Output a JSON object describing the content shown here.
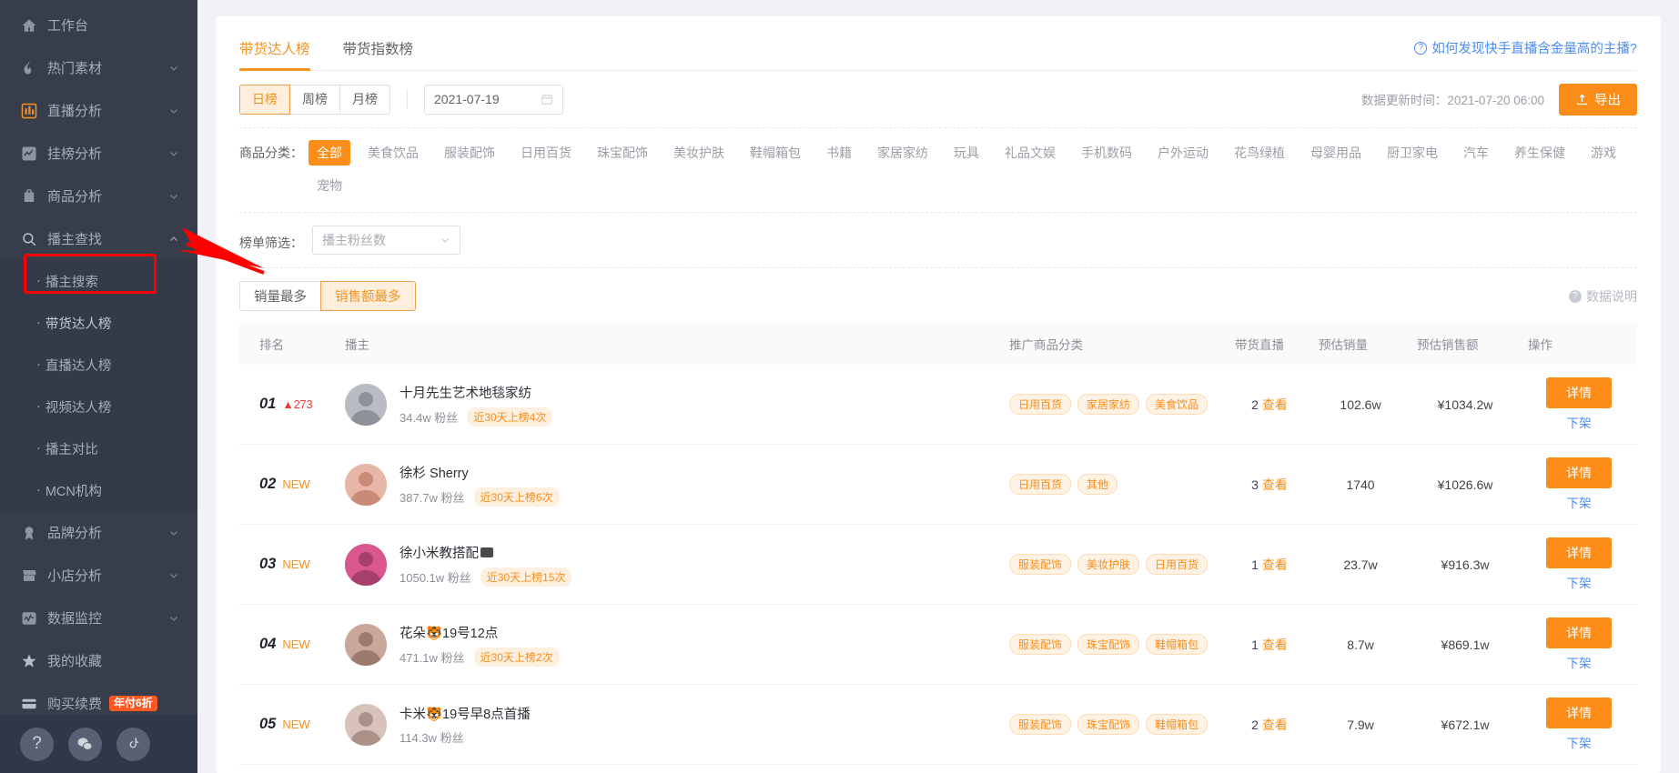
{
  "sidebar": {
    "items": [
      {
        "label": "工作台",
        "icon": "home-icon",
        "expandable": false,
        "id": "workbench"
      },
      {
        "label": "热门素材",
        "icon": "fire-icon",
        "expandable": true,
        "id": "hot-material"
      },
      {
        "label": "直播分析",
        "icon": "bar-chart-icon",
        "expandable": true,
        "id": "live-analysis"
      },
      {
        "label": "挂榜分析",
        "icon": "trend-icon",
        "expandable": true,
        "id": "rank-analysis"
      },
      {
        "label": "商品分析",
        "icon": "bag-icon",
        "expandable": true,
        "id": "product-analysis"
      },
      {
        "label": "播主查找",
        "icon": "search-icon",
        "expandable": true,
        "expanded": true,
        "id": "host-find"
      }
    ],
    "sub_items": [
      {
        "label": "播主搜索",
        "id": "host-search"
      },
      {
        "label": "带货达人榜",
        "id": "带货达人榜",
        "highlighted": true
      },
      {
        "label": "直播达人榜",
        "id": "live-talent-rank"
      },
      {
        "label": "视频达人榜",
        "id": "video-talent-rank"
      },
      {
        "label": "播主对比",
        "id": "host-compare"
      },
      {
        "label": "MCN机构",
        "id": "mcn-agency"
      }
    ],
    "items_bottom": [
      {
        "label": "品牌分析",
        "icon": "medal-icon",
        "expandable": true,
        "id": "brand-analysis"
      },
      {
        "label": "小店分析",
        "icon": "shop-icon",
        "expandable": true,
        "id": "shop-analysis"
      },
      {
        "label": "数据监控",
        "icon": "monitor-icon",
        "expandable": true,
        "id": "data-monitor"
      },
      {
        "label": "我的收藏",
        "icon": "star-icon",
        "expandable": false,
        "id": "my-favorites"
      },
      {
        "label": "购买续费",
        "icon": "card-icon",
        "expandable": false,
        "id": "purchase-renew",
        "badge": "年付6折"
      }
    ],
    "footer_icons": [
      "question-icon",
      "wechat-icon",
      "douyin-icon"
    ]
  },
  "tabs": [
    {
      "label": "带货达人榜",
      "active": true
    },
    {
      "label": "带货指数榜",
      "active": false
    }
  ],
  "howto_link": "如何发现快手直播含金量高的主播?",
  "period": {
    "options": [
      {
        "label": "日榜",
        "active": true
      },
      {
        "label": "周榜",
        "active": false
      },
      {
        "label": "月榜",
        "active": false
      }
    ],
    "date_value": "2021-07-19"
  },
  "update_time": "数据更新时间：2021-07-20 06:00",
  "export_label": "导出",
  "category_filter": {
    "label": "商品分类：",
    "categories": [
      {
        "label": "全部",
        "active": true
      },
      {
        "label": "美食饮品",
        "active": false
      },
      {
        "label": "服装配饰",
        "active": false
      },
      {
        "label": "日用百货",
        "active": false
      },
      {
        "label": "珠宝配饰",
        "active": false
      },
      {
        "label": "美妆护肤",
        "active": false
      },
      {
        "label": "鞋帽箱包",
        "active": false
      },
      {
        "label": "书籍",
        "active": false
      },
      {
        "label": "家居家纺",
        "active": false
      },
      {
        "label": "玩具",
        "active": false
      },
      {
        "label": "礼品文娱",
        "active": false
      },
      {
        "label": "手机数码",
        "active": false
      },
      {
        "label": "户外运动",
        "active": false
      },
      {
        "label": "花鸟绿植",
        "active": false
      },
      {
        "label": "母婴用品",
        "active": false
      },
      {
        "label": "厨卫家电",
        "active": false
      },
      {
        "label": "汽车",
        "active": false
      },
      {
        "label": "养生保健",
        "active": false
      },
      {
        "label": "游戏",
        "active": false
      },
      {
        "label": "宠物",
        "active": false
      }
    ]
  },
  "list_filter": {
    "label": "榜单筛选：",
    "selected": "播主粉丝数"
  },
  "sort": {
    "options": [
      {
        "label": "销量最多",
        "active": false
      },
      {
        "label": "销售额最多",
        "active": true
      }
    ],
    "data_note": "数据说明"
  },
  "table": {
    "headers": [
      "排名",
      "播主",
      "推广商品分类",
      "带货直播",
      "预估销量",
      "预估销售额",
      "操作"
    ],
    "rows": [
      {
        "rank": "01",
        "rank_change": "273",
        "rank_change_type": "up",
        "name": "十月先生艺术地毯家纺",
        "name_badge": "",
        "fans": "34.4w 粉丝",
        "ontop": "近30天上榜4次",
        "tags": [
          "日用百货",
          "家居家纺",
          "美食饮品"
        ],
        "live_count": "2",
        "live_link": "查看",
        "est_sales": "102.6w",
        "est_amount": "¥1034.2w",
        "detail": "详情",
        "offshelf": "下架"
      },
      {
        "rank": "02",
        "rank_change": "NEW",
        "rank_change_type": "new",
        "name": "徐杉 Sherry",
        "name_badge": "",
        "fans": "387.7w 粉丝",
        "ontop": "近30天上榜6次",
        "tags": [
          "日用百货",
          "其他"
        ],
        "live_count": "3",
        "live_link": "查看",
        "est_sales": "1740",
        "est_amount": "¥1026.6w",
        "detail": "详情",
        "offshelf": "下架"
      },
      {
        "rank": "03",
        "rank_change": "NEW",
        "rank_change_type": "new",
        "name": "徐小米教搭配",
        "name_badge": "verified",
        "fans": "1050.1w 粉丝",
        "ontop": "近30天上榜15次",
        "tags": [
          "服装配饰",
          "美妆护肤",
          "日用百货"
        ],
        "live_count": "1",
        "live_link": "查看",
        "est_sales": "23.7w",
        "est_amount": "¥916.3w",
        "detail": "详情",
        "offshelf": "下架"
      },
      {
        "rank": "04",
        "rank_change": "NEW",
        "rank_change_type": "new",
        "name": "花朵🐯19号12点",
        "name_badge": "",
        "fans": "471.1w 粉丝",
        "ontop": "近30天上榜2次",
        "tags": [
          "服装配饰",
          "珠宝配饰",
          "鞋帽箱包"
        ],
        "live_count": "1",
        "live_link": "查看",
        "est_sales": "8.7w",
        "est_amount": "¥869.1w",
        "detail": "详情",
        "offshelf": "下架"
      },
      {
        "rank": "05",
        "rank_change": "NEW",
        "rank_change_type": "new",
        "name": "卡米🐯19号早8点首播",
        "name_badge": "",
        "fans": "114.3w 粉丝",
        "ontop": "",
        "tags": [
          "服装配饰",
          "珠宝配饰",
          "鞋帽箱包"
        ],
        "live_count": "2",
        "live_link": "查看",
        "est_sales": "7.9w",
        "est_amount": "¥672.1w",
        "detail": "详情",
        "offshelf": "下架"
      }
    ]
  },
  "colors": {
    "accent": "#fb8c18",
    "link": "#4a8cf7",
    "sidebar_bg": "#373d4b",
    "highlight_box": "#ff0000"
  }
}
